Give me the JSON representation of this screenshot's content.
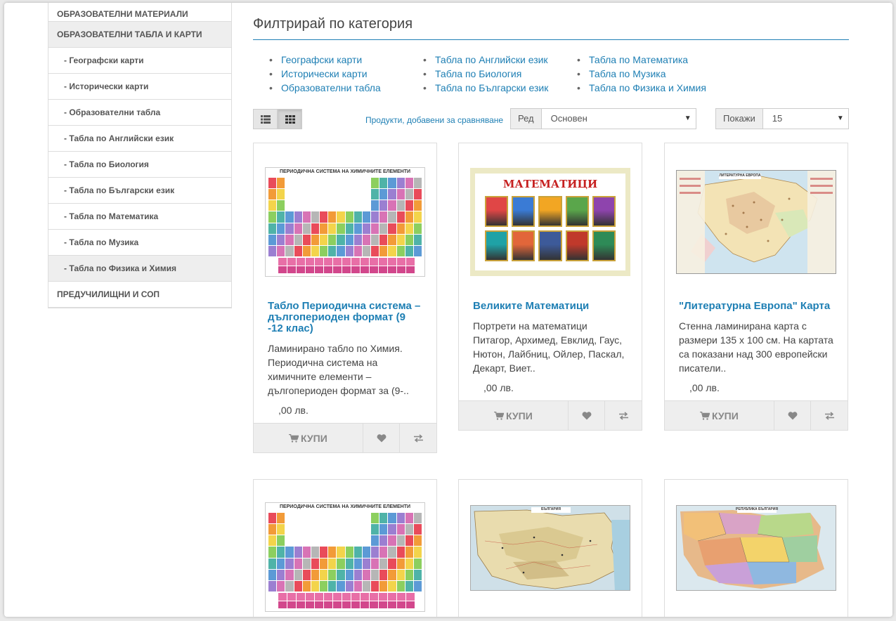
{
  "sidebar": {
    "items": [
      {
        "label": "ОБРАЗОВАТЕЛНИ МАТЕРИАЛИ"
      },
      {
        "label": "ОБРАЗОВАТЕЛНИ ТАБЛА И КАРТИ"
      },
      {
        "label": "- Географски карти"
      },
      {
        "label": "- Исторически карти"
      },
      {
        "label": "- Образователни табла"
      },
      {
        "label": "- Табла по Английски език"
      },
      {
        "label": "- Табла по Биология"
      },
      {
        "label": "- Табла по Български език"
      },
      {
        "label": "- Табла по Математика"
      },
      {
        "label": "- Табла по Музика"
      },
      {
        "label": "- Табла по Физика и Химия"
      },
      {
        "label": "ПРЕДУЧИЛИЩНИ И СОП"
      }
    ]
  },
  "filter": {
    "title": "Филтрирай по категория",
    "col1": [
      "Географски карти",
      "Исторически карти",
      "Образователни табла"
    ],
    "col2": [
      "Табла по Английски език",
      "Табла по Биология",
      "Табла по Български език"
    ],
    "col3": [
      "Табла по Математика",
      "Табла по Музика",
      "Табла по Физика и Химия"
    ]
  },
  "toolbar": {
    "compare_link": "Продукти, добавени за сравняване",
    "sort_label": "Ред",
    "sort_value": "Основен",
    "limit_label": "Покажи",
    "limit_value": "15"
  },
  "products": [
    {
      "name": "Табло Периодична система – дългопериоден формат (9 -12 клас)",
      "description": "Ламинирано табло по Химия. Периодична система на химичните елементи – дългопериоден формат за (9-..",
      "price": ",00 лв.",
      "image_title": "ПЕРИОДИЧНА СИСТЕМА НА ХИМИЧНИТЕ ЕЛЕМЕНТИ"
    },
    {
      "name": "Великите Математици",
      "description": "Портрети на математици Питагор, Архимед, Евклид, Гаус, Нютон, Лайбниц, Ойлер, Паскал, Декарт, Виет..",
      "price": ",00 лв.",
      "image_title": "МАТЕМАТИЦИ"
    },
    {
      "name": "\"Литературна Европа\" Карта",
      "description": "Стенна ламинирана карта с размери 135 х 100 см. На картата са показани над 300 европейски писатели..",
      "price": ",00 лв.",
      "image_title": "ЛИТЕРАТУРНА ЕВРОПА"
    }
  ],
  "bottom_images": [
    {
      "title": "ПЕРИОДИЧНА СИСТЕМА НА ХИМИЧНИТЕ ЕЛЕМЕНТИ"
    },
    {
      "title": "БЪЛГАРИЯ"
    },
    {
      "title": "РЕПУБЛИКА БЪЛГАРИЯ"
    }
  ],
  "buttons": {
    "buy": "КУПИ"
  },
  "colors": {
    "link": "#1e7fb4",
    "accent_rule": "#1e7fb4"
  }
}
